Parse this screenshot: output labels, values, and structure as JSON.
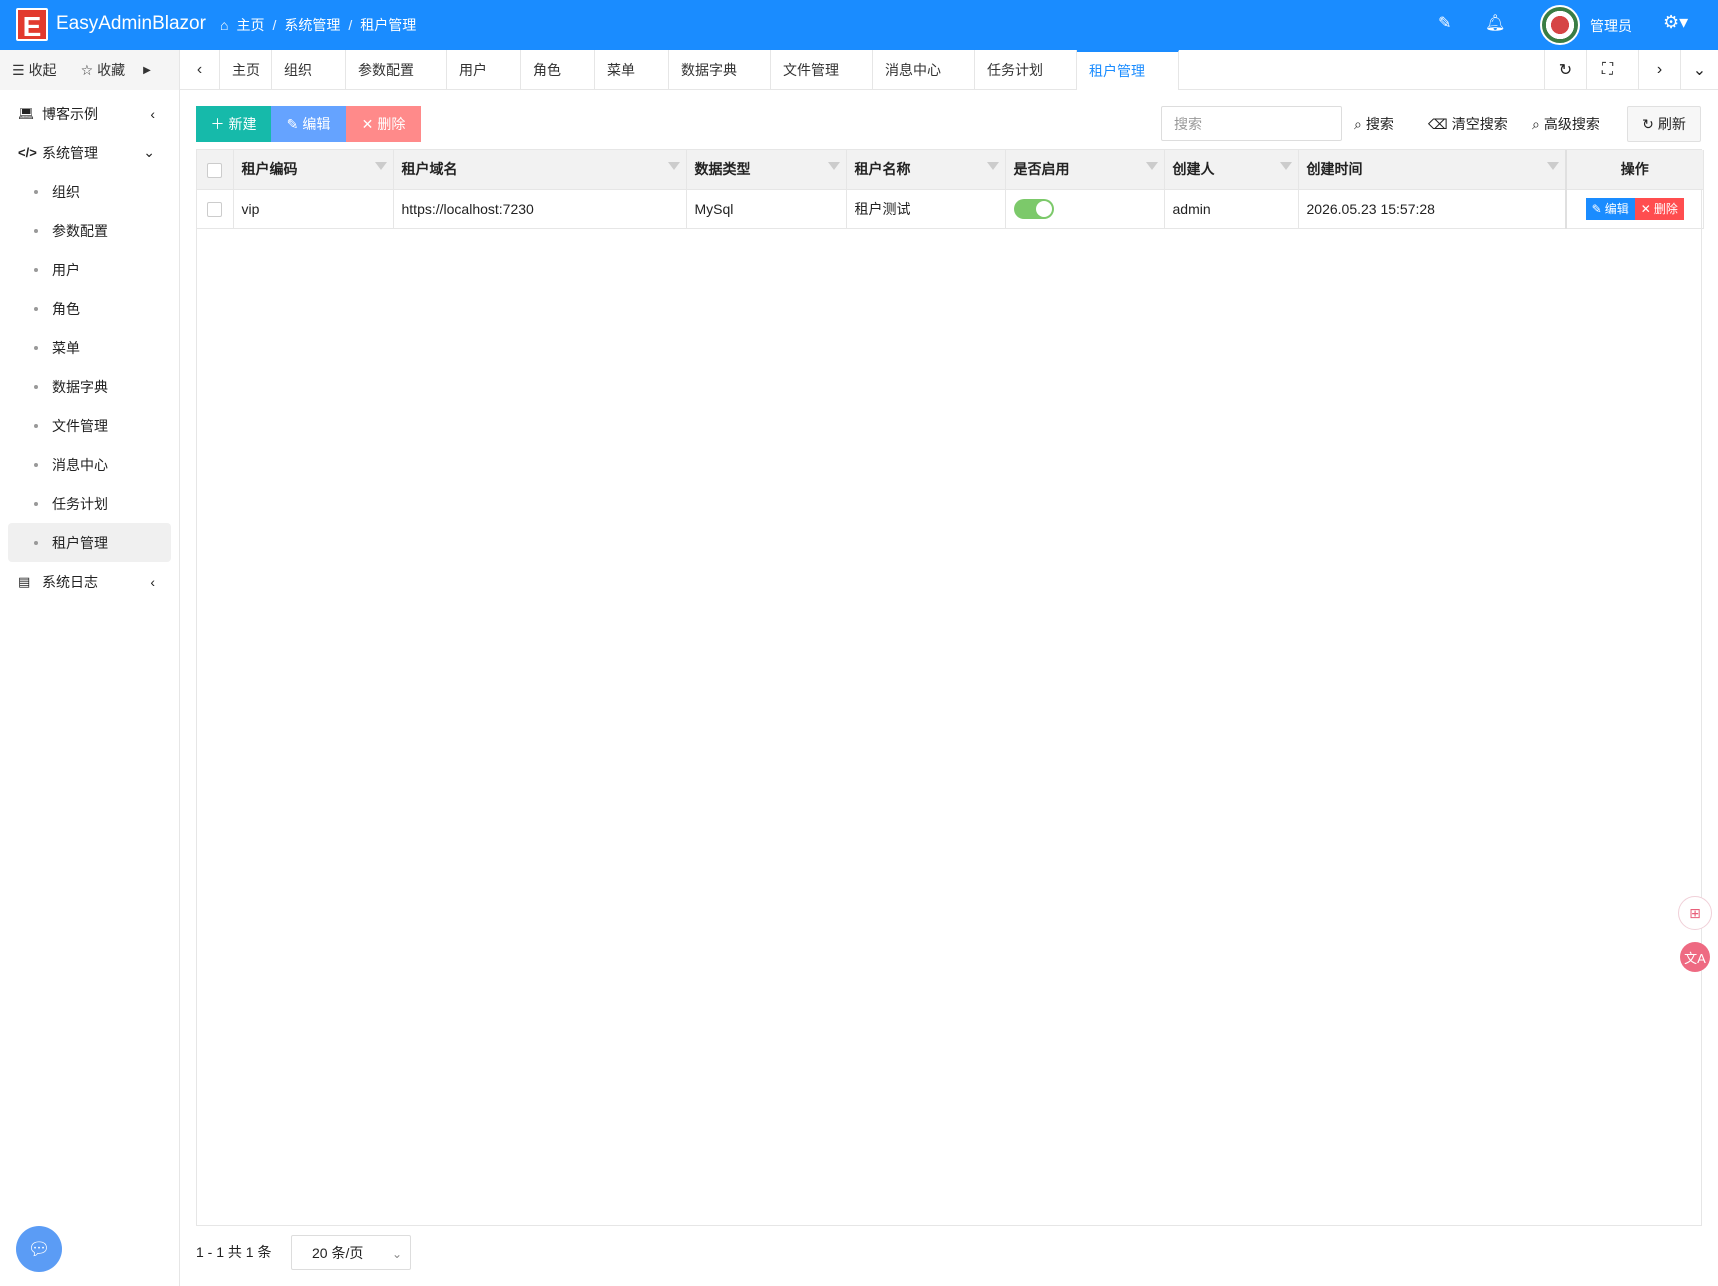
{
  "app": {
    "logo_letter": "E",
    "title": "EasyAdminBlazor"
  },
  "breadcrumb": {
    "items": [
      "主页",
      "系统管理",
      "租户管理"
    ],
    "separator": "/"
  },
  "header": {
    "user_name": "管理员"
  },
  "side_head": {
    "collapse_label": "收起",
    "favorite_label": "收藏"
  },
  "tabs": [
    "主页",
    "组织",
    "参数配置",
    "用户",
    "角色",
    "菜单",
    "数据字典",
    "文件管理",
    "消息中心",
    "任务计划",
    "租户管理"
  ],
  "active_tab_index": 10,
  "sidebar": {
    "groups": [
      {
        "label": "博客示例"
      },
      {
        "label": "系统管理"
      },
      {
        "label": "系统日志"
      }
    ],
    "items": [
      "组织",
      "参数配置",
      "用户",
      "角色",
      "菜单",
      "数据字典",
      "文件管理",
      "消息中心",
      "任务计划",
      "租户管理"
    ]
  },
  "toolbar": {
    "new_label": "新建",
    "edit_label": "编辑",
    "delete_label": "删除",
    "search_placeholder": "搜索",
    "search_label": "搜索",
    "clear_search_label": "清空搜索",
    "advanced_search_label": "高级搜索",
    "refresh_label": "刷新"
  },
  "table": {
    "columns": [
      "租户编码",
      "租户域名",
      "数据类型",
      "租户名称",
      "是否启用",
      "创建人",
      "创建时间",
      "操作"
    ],
    "rows": [
      {
        "code": "vip",
        "domain": "https://localhost:7230",
        "db_type": "MySql",
        "name": "租户测试",
        "enabled": true,
        "creator": "admin",
        "created_at": "2026.05.23 15:57:28",
        "edit_label": "编辑",
        "delete_label": "删除"
      }
    ]
  },
  "pager": {
    "summary": "1 - 1 共 1 条",
    "page_size": "20 条/页"
  },
  "colors": {
    "primary": "#1a8cff",
    "success": "#16baaa",
    "edit": "#65a3ff",
    "danger": "#ff8a8a",
    "row_edit": "#1a8cff",
    "row_delete": "#ff4d4f"
  }
}
